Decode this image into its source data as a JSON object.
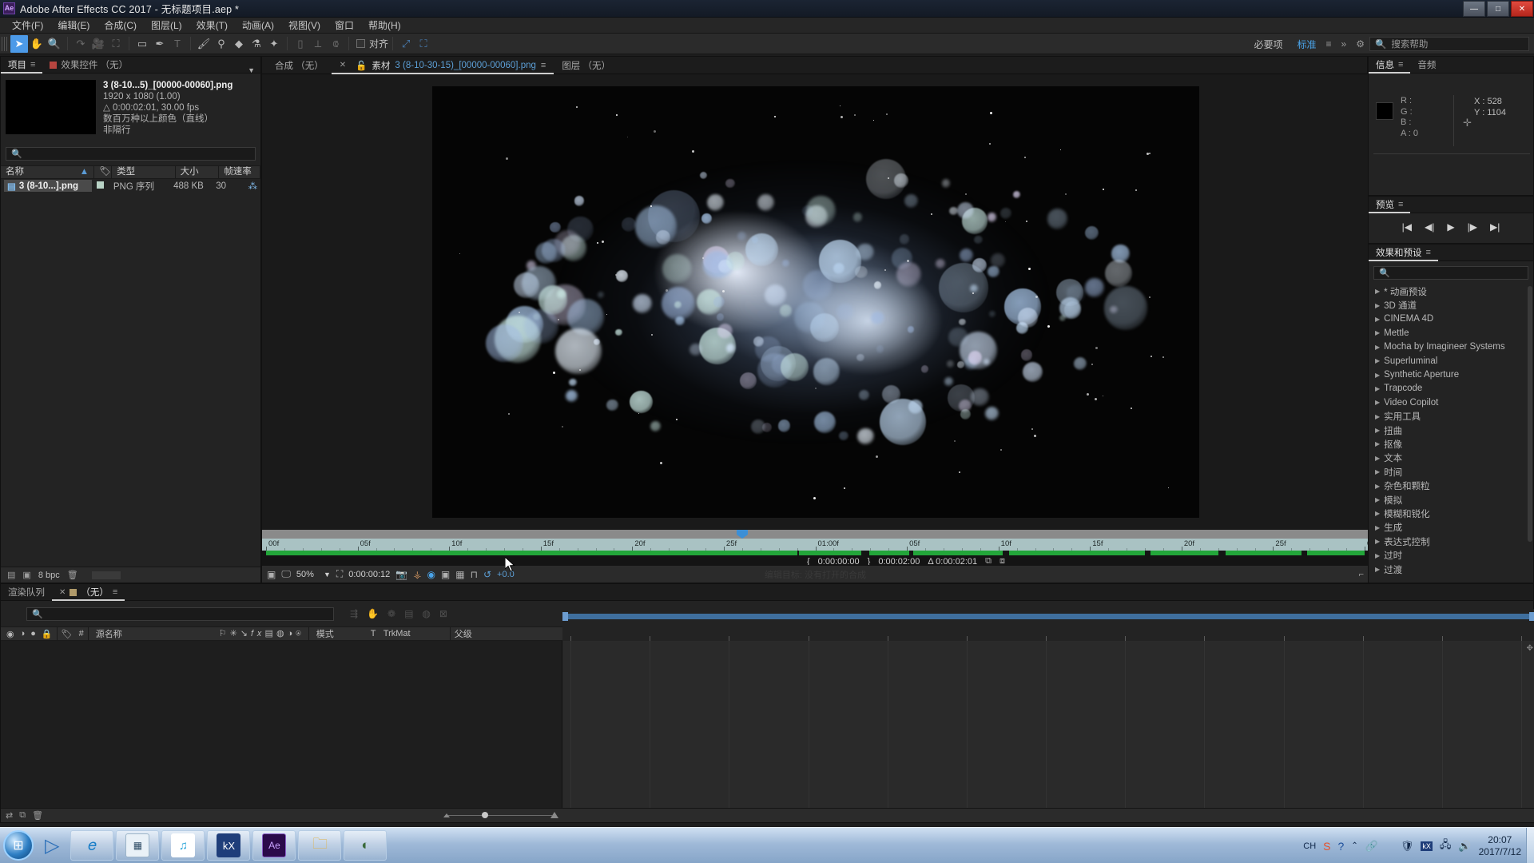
{
  "window": {
    "title": "Adobe After Effects CC 2017 - 无标题项目.aep *",
    "app_badge": "Ae",
    "minimize": "—",
    "maximize": "□",
    "close": "✕"
  },
  "menubar": {
    "items": [
      "文件(F)",
      "编辑(E)",
      "合成(C)",
      "图层(L)",
      "效果(T)",
      "动画(A)",
      "视图(V)",
      "窗口",
      "帮助(H)"
    ]
  },
  "toolbar": {
    "snap_label": "对齐",
    "workspace_label": "必要项",
    "workspace_active": "标准",
    "menu_icon": "≡",
    "chevron_icon": "»",
    "search_placeholder": "搜索帮助"
  },
  "project_panel": {
    "tabs": [
      {
        "label": "项目",
        "active": true
      },
      {
        "label": "效果控件 （无）",
        "active": false
      }
    ],
    "item": {
      "name": "3 (8-10...5)_[00000-00060].png",
      "dimensions": "1920 x 1080 (1.00)",
      "duration": "0:00:02:01, 30.00 fps",
      "color": "数百万种以上颜色（直线）",
      "interlace": "非隔行"
    },
    "search_placeholder": "",
    "columns": [
      "名称",
      "类型",
      "大小",
      "帧速率"
    ],
    "rows": [
      {
        "name": "3 (8-10...].png",
        "type": "PNG 序列",
        "size": "488 KB",
        "fps": "30"
      }
    ],
    "footer": {
      "bpc": "8 bpc"
    }
  },
  "viewer_panel": {
    "tabs": [
      {
        "label": "合成 （无）",
        "active": false,
        "prefix": "",
        "closeable": false
      },
      {
        "label": "素材",
        "filename": "3 (8-10-30-15)_[00000-00060].png",
        "active": true,
        "closeable": true
      },
      {
        "label": "图层 （无）",
        "active": false,
        "closeable": false
      }
    ],
    "ruler_labels": [
      "00f",
      "05f",
      "10f",
      "15f",
      "20f",
      "25f",
      "01:00f",
      "05f",
      "10f",
      "15f",
      "20f",
      "25f",
      "02:00f"
    ],
    "in_point": "0:00:00:00",
    "out_point": "0:00:02:00",
    "duration": "Δ 0:00:02:01",
    "zoom": "50%",
    "current_time": "0:00:00:12",
    "exposure": "+0.0",
    "edit_target_text": "编辑目标: 没有打开的合成"
  },
  "info_panel": {
    "tabs": [
      {
        "label": "信息",
        "active": true
      },
      {
        "label": "音频",
        "active": false
      }
    ],
    "r": "R :",
    "g": "G :",
    "b": "B :",
    "a": "A : 0",
    "x": "X : 528",
    "y": "Y : 1104"
  },
  "preview_panel": {
    "title": "预览",
    "controls": [
      "first-frame",
      "prev-frame",
      "play",
      "next-frame",
      "last-frame"
    ]
  },
  "effects_panel": {
    "title": "效果和预设",
    "search_placeholder": "",
    "items": [
      "* 动画预设",
      "3D 通道",
      "CINEMA 4D",
      "Mettle",
      "Mocha by Imagineer Systems",
      "Superluminal",
      "Synthetic Aperture",
      "Trapcode",
      "Video Copilot",
      "实用工具",
      "扭曲",
      "抠像",
      "文本",
      "时间",
      "杂色和颗粒",
      "模拟",
      "模糊和锐化",
      "生成",
      "表达式控制",
      "过时",
      "过渡"
    ]
  },
  "timeline_panel": {
    "tabs": [
      {
        "label": "渲染队列",
        "active": false
      },
      {
        "label": "（无）",
        "active": true
      }
    ],
    "search_placeholder": "",
    "columns": [
      "#",
      "源名称",
      "模式",
      "T",
      "TrkMat",
      "父级"
    ],
    "switch_icons": [
      "eye-icon",
      "audio-icon",
      "solo-icon",
      "lock-icon"
    ],
    "zoom_level": ""
  },
  "taskbar": {
    "start": "start-orb",
    "buttons": [
      "internet-explorer",
      "calculator",
      "kugou",
      "kx-driver",
      "after-effects",
      "file-explorer",
      "screen-recorder"
    ],
    "tray": [
      "CH",
      "sogou-icon",
      "help-icon",
      "chevron-icon",
      "link-icon",
      "shield-icon",
      "kx-icon",
      "network-icon",
      "volume-icon"
    ],
    "time": "20:07",
    "date": "2017/7/12"
  },
  "colors": {
    "accent": "#4aa3e8",
    "work_green": "#23a63a",
    "ruler": "#a9c2c3",
    "panel_bg": "#232323"
  }
}
